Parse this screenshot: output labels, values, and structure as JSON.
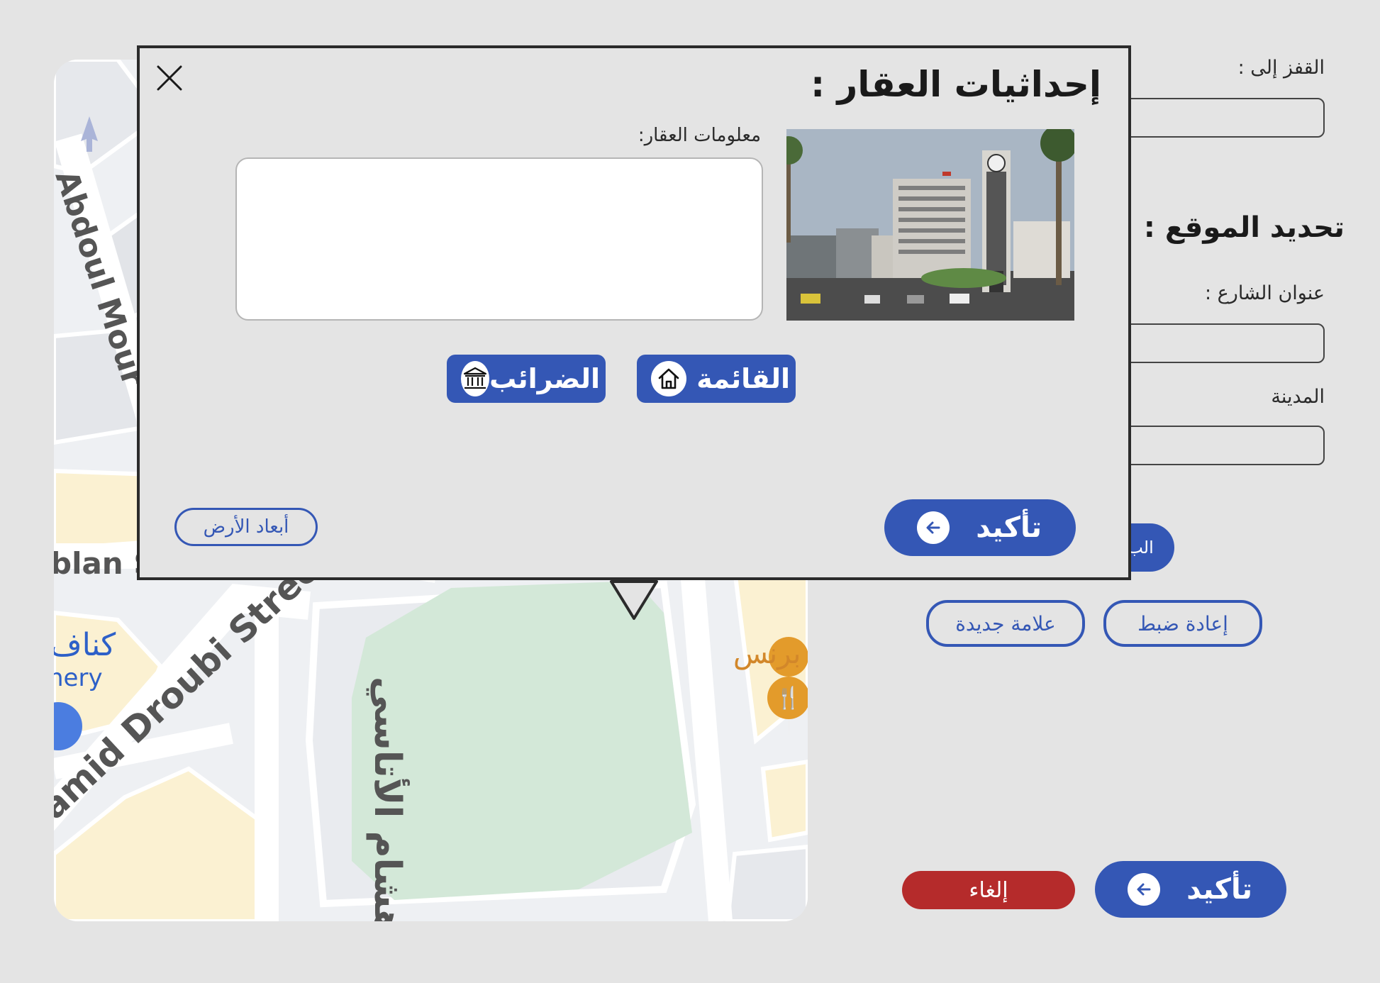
{
  "side": {
    "jump_label": "القفز إلى :",
    "section_title": "تحديد الموقع :",
    "street_label": "عنوان الشارع :",
    "city_label": "المدينة",
    "hidden_button_label": "الب",
    "reset_label": "إعادة ضبط",
    "new_marker_label": "علامة جديدة",
    "confirm_label": "تأكيد",
    "cancel_label": "إلغاء"
  },
  "dialog": {
    "title": "إحداثيات العقار :",
    "info_label": "معلومات العقار:",
    "info_value": "",
    "menu_button": "القائمة",
    "taxes_button": "الضرائب",
    "confirm_label": "تأكيد",
    "land_dims_label": "أبعاد الأرض"
  },
  "map": {
    "labels": {
      "abdoul": "Abdoul Mour",
      "blan": "blan S",
      "droubi": "amid Droubi Street",
      "hisham": "هشام الأتاسي",
      "kunafa_ar": "كناف",
      "kunafa_en": "nery",
      "restaurant_ar": "برنس"
    }
  },
  "colors": {
    "accent_blue": "#3457b5",
    "danger_red": "#b52b2b",
    "background": "#e4e4e4",
    "park_green": "#d3e8d8",
    "block_yellow": "#fbf1d2",
    "poi_orange": "#e39b2b"
  }
}
